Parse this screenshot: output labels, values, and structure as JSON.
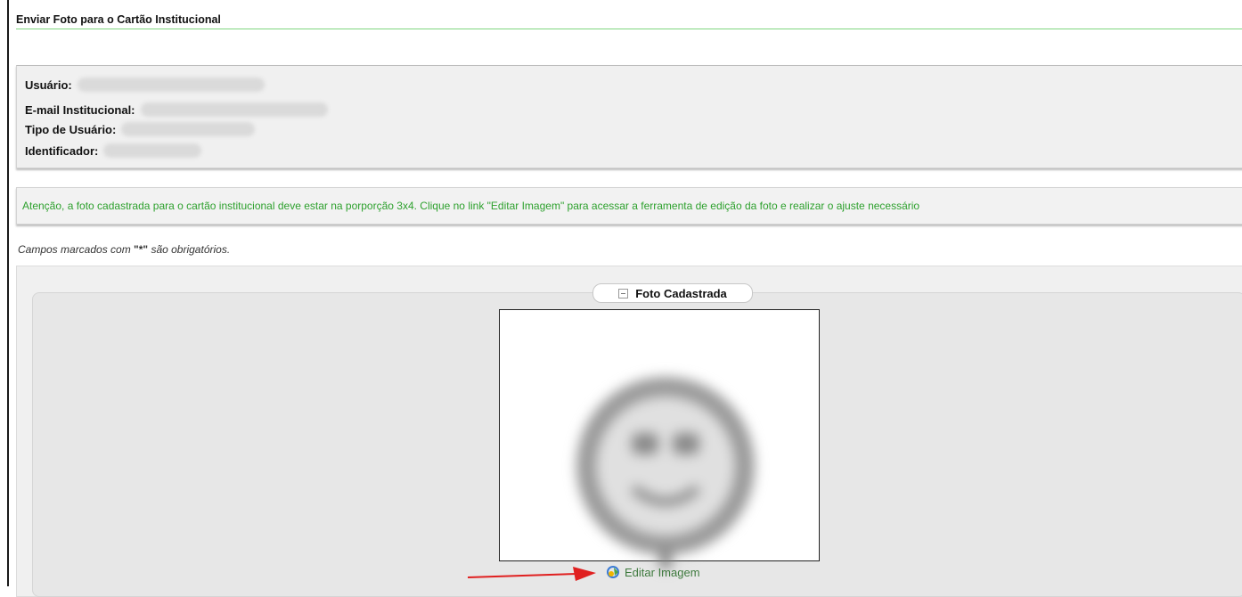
{
  "page": {
    "title": "Enviar Foto para o Cartão Institucional"
  },
  "user_info": {
    "usuario_label": "Usuário:",
    "email_label": "E-mail Institucional:",
    "tipo_label": "Tipo de Usuário:",
    "identificador_label": "Identificador:"
  },
  "notice": {
    "text": "Atenção, a foto cadastrada para o cartão institucional deve estar na porporção 3x4. Clique no link \"Editar Imagem\" para acessar a ferramenta de edição da foto e realizar o ajuste necessário"
  },
  "form": {
    "required_prefix": "Campos marcados com ",
    "required_marker": "\"*\"",
    "required_suffix": " são obrigatórios."
  },
  "photo_section": {
    "legend": "Foto Cadastrada",
    "edit_link": "Editar Imagem",
    "edit_icon": "edit-image-icon",
    "collapse_icon": "collapse-icon"
  },
  "colors": {
    "notice_text": "#2ea12e",
    "title_rule": "#7fd67f",
    "link": "#3e7a3e",
    "arrow": "#e02020"
  }
}
